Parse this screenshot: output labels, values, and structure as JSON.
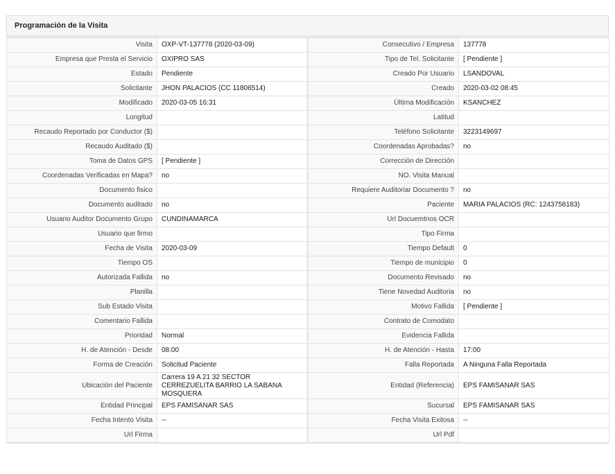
{
  "panel": {
    "title": "Programación de la Visita"
  },
  "rows": [
    {
      "l1": "Visita",
      "v1": "OXP-VT-137778 (2020-03-09)",
      "l2": "Consecutivo / Empresa",
      "v2": "137778"
    },
    {
      "l1": "Empresa que Presta el Servicio",
      "v1": "OXIPRO SAS",
      "l2": "Tipo de Tel. Solicitante",
      "v2": "[ Pendiente ]"
    },
    {
      "l1": "Estado",
      "v1": "Pendiente",
      "l2": "Creado Por Usuario",
      "v2": "LSANDOVAL"
    },
    {
      "l1": "Solicitante",
      "v1": "JHON PALACIOS (CC 11806514)",
      "l2": "Creado",
      "v2": "2020-03-02 08:45"
    },
    {
      "l1": "Modificado",
      "v1": "2020-03-05 16:31",
      "l2": "Última Modificación",
      "v2": "KSANCHEZ"
    },
    {
      "l1": "Longitud",
      "v1": "",
      "l2": "Latitud",
      "v2": ""
    },
    {
      "l1": "Recaudo Reportado por Conductor ($)",
      "v1": "",
      "l2": "Teléfono Solicitante",
      "v2": "3223149697"
    },
    {
      "l1": "Recaudo Auditado ($)",
      "v1": "",
      "l2": "Coordenadas Aprobadas?",
      "v2": "no"
    },
    {
      "l1": "Toma de Datos GPS",
      "v1": "[ Pendiente ]",
      "l2": "Corrección de Dirección",
      "v2": ""
    },
    {
      "l1": "Coordenadas Verificadas en Mapa?",
      "v1": "no",
      "l2": "NO. Visita Manual",
      "v2": ""
    },
    {
      "l1": "Documento fisico",
      "v1": "",
      "l2": "Requiere Auditoriar Documento ?",
      "v2": "no"
    },
    {
      "l1": "Documento auditado",
      "v1": "no",
      "l2": "Paciente",
      "v2": "MARIA PALACIOS (RC: 1243758183)"
    },
    {
      "l1": "Usuario Auditor Documento Grupo",
      "v1": "CUNDINAMARCA",
      "l2": "Url Docuemtnos OCR",
      "v2": ""
    },
    {
      "l1": "Usuario que firmo",
      "v1": "",
      "l2": "Tipo Firma",
      "v2": ""
    },
    {
      "l1": "Fecha de Visita",
      "v1": "2020-03-09",
      "l2": "Tiempo Default",
      "v2": "0"
    },
    {
      "l1": "Tiempo OS",
      "v1": "",
      "l2": "Tiempo de municipio",
      "v2": "0"
    },
    {
      "l1": "Autorizada Fallida",
      "v1": "no",
      "l2": "Documento Revisado",
      "v2": "no"
    },
    {
      "l1": "Planilla",
      "v1": "",
      "l2": "Tiene Novedad Auditoria",
      "v2": "no"
    },
    {
      "l1": "Sub Estado Visita",
      "v1": "",
      "l2": "Motivo Fallida",
      "v2": "[ Pendiente ]"
    },
    {
      "l1": "Comentario Fallida",
      "v1": "",
      "l2": "Contrato de Comodato",
      "v2": ""
    },
    {
      "l1": "Prioridad",
      "v1": "Normal",
      "l2": "Evidencia Fallida",
      "v2": ""
    },
    {
      "l1": "H. de Atención - Desde",
      "v1": "08:00",
      "l2": "H. de Atención - Hasta",
      "v2": "17:00"
    },
    {
      "l1": "Forma de Creación",
      "v1": "Solicitud Paciente",
      "l2": "Falla Reportada",
      "v2": "A Ninguna Falla Reportada"
    },
    {
      "l1": "Ubicación del Paciente",
      "v1": "Carrera 19 A 21 32 SECTOR CERREZUELITA BARRIO LA SABANA MOSQUERA",
      "l2": "Entidad (Referencia)",
      "v2": "EPS FAMISANAR SAS",
      "tall": true
    },
    {
      "l1": "Entidad Principal",
      "v1": "EPS FAMISANAR SAS",
      "l2": "Sucursal",
      "v2": "EPS FAMISANAR SAS"
    },
    {
      "l1": "Fecha Intento Visita",
      "v1": "--",
      "l2": "Fecha Visita Exitosa",
      "v2": "--"
    },
    {
      "l1": "Url Firma",
      "v1": "",
      "l2": "Url Pdf",
      "v2": ""
    }
  ]
}
